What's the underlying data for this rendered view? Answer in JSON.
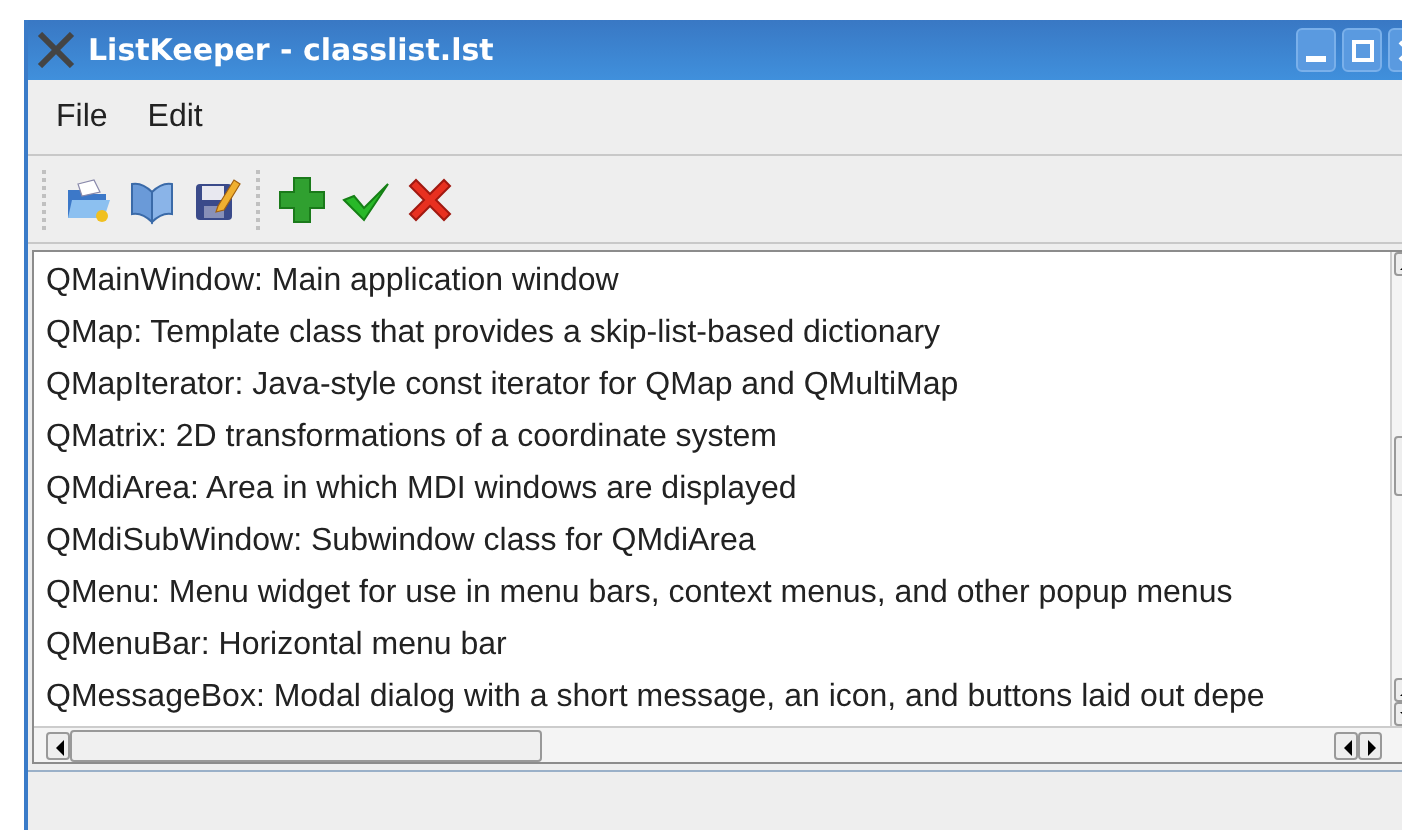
{
  "window": {
    "title": "ListKeeper - classlist.lst"
  },
  "menu": [
    "File",
    "Edit"
  ],
  "list": {
    "items": [
      "QMainWindow: Main application window",
      "QMap: Template class that provides a skip-list-based dictionary",
      "QMapIterator: Java-style const iterator for QMap and QMultiMap",
      "QMatrix: 2D transformations of a coordinate system",
      "QMdiArea: Area in which MDI windows are displayed",
      "QMdiSubWindow: Subwindow class for QMdiArea",
      "QMenu: Menu widget for use in menu bars, context menus, and other popup menus",
      "QMenuBar: Horizontal menu bar",
      "QMessageBox: Modal dialog with a short message, an icon, and buttons laid out depe"
    ]
  }
}
